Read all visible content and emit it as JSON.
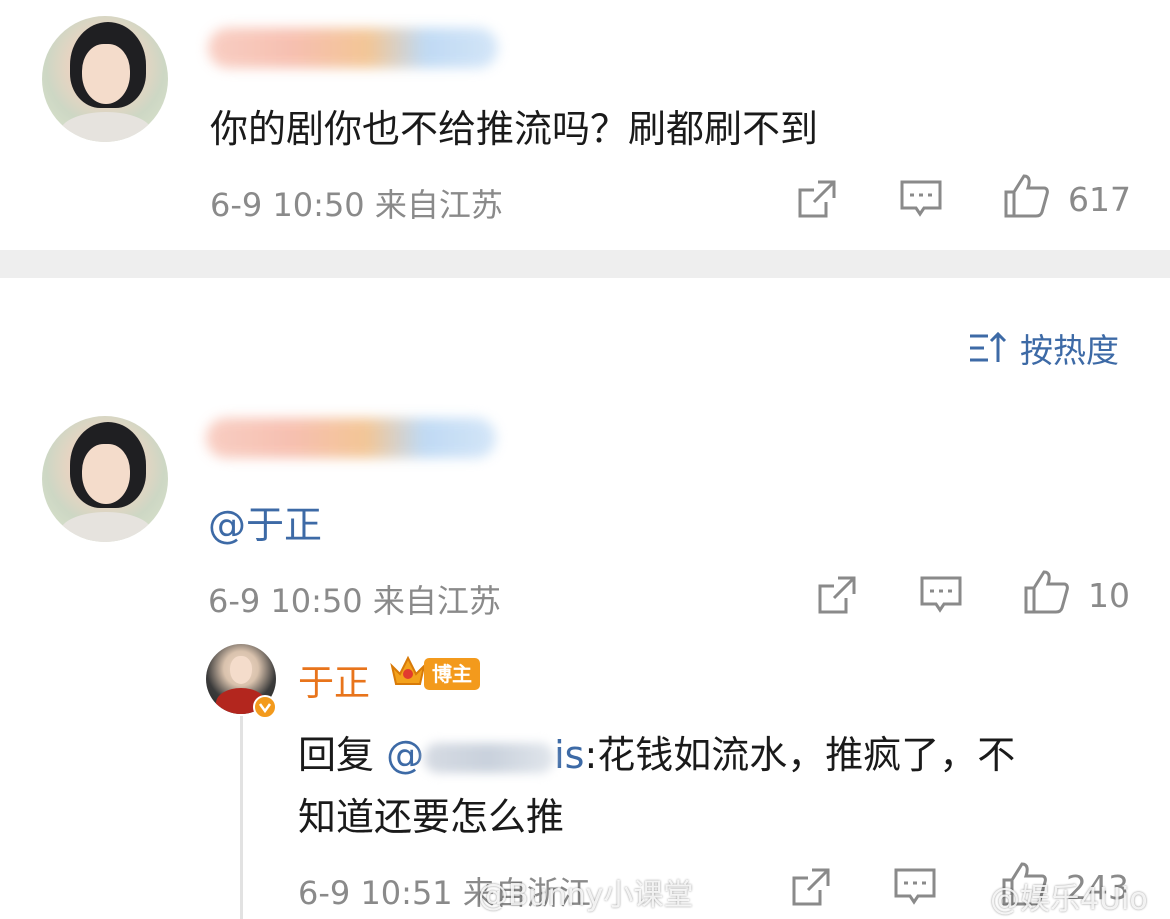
{
  "comment1": {
    "text": "你的剧你也不给推流吗？刷都刷不到",
    "meta": "6-9 10:50  来自江苏",
    "like_count": "617"
  },
  "sort_label": "按热度",
  "comment2": {
    "text": "@于正",
    "meta": "6-9 10:50  来自江苏",
    "like_count": "10"
  },
  "reply": {
    "author": "于正",
    "badge": "博主",
    "prefix": "回复 ",
    "mention": "@",
    "mention_tail": "is",
    "line1": ":花钱如流水，推疯了，不",
    "line2": "知道还要怎么推",
    "meta": "6-9 10:51  来自浙江",
    "like_count": "243"
  },
  "watermarks": {
    "left": "@Bunny小课堂",
    "right": "@娱乐4Uio"
  },
  "icons": [
    "share-icon",
    "comment-icon",
    "like-icon",
    "sort-icon",
    "verified-icon"
  ],
  "colors": {
    "link_blue": "#3d6aa6",
    "meta_gray": "#8a8a8a",
    "author_orange": "#e8741b",
    "badge_orange": "#f39a1c"
  }
}
